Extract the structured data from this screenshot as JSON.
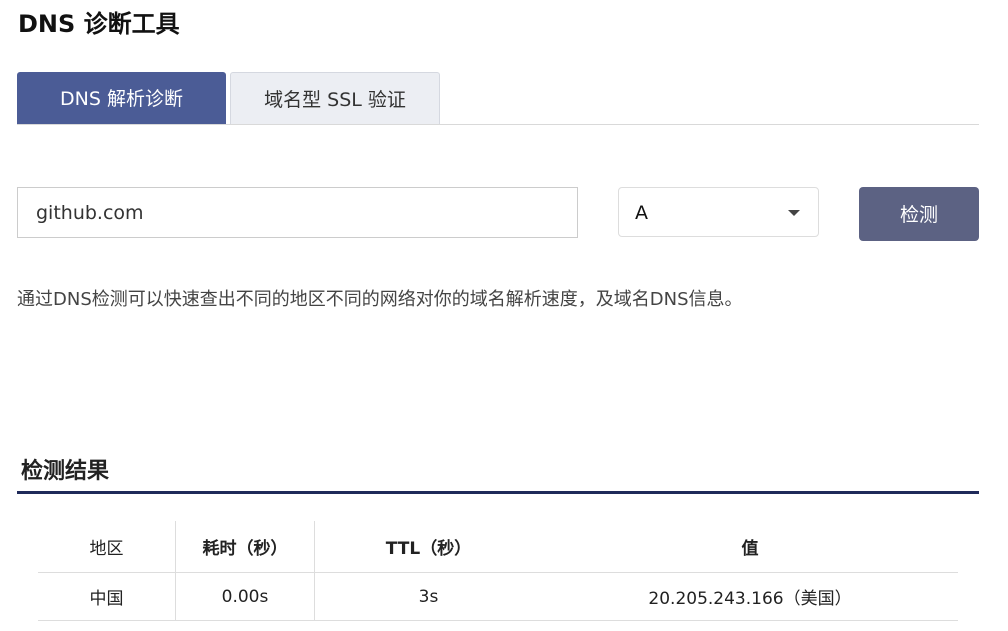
{
  "page": {
    "title": "DNS 诊断工具"
  },
  "tabs": [
    {
      "label": "DNS 解析诊断",
      "active": true
    },
    {
      "label": "域名型 SSL 验证",
      "active": false
    }
  ],
  "form": {
    "domain_value": "github.com",
    "record_type": "A",
    "check_label": "检测"
  },
  "description": "通过DNS检测可以快速查出不同的地区不同的网络对你的域名解析速度，及域名DNS信息。",
  "results": {
    "title": "检测结果",
    "columns": [
      "地区",
      "耗时（秒）",
      "TTL（秒）",
      "值"
    ],
    "rows": [
      [
        "中国",
        "0.00s",
        "3s",
        "20.205.243.166（美国）"
      ]
    ]
  },
  "colors": {
    "accent": "#4b5c96",
    "button": "#5c6283",
    "rule": "#1f2a5a"
  },
  "icons": {
    "select_caret": "chevron-down-icon"
  }
}
